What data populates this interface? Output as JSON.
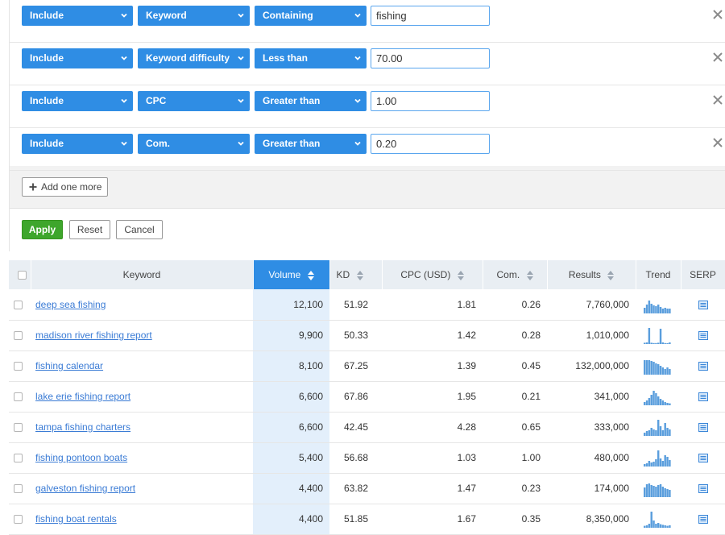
{
  "filters": [
    {
      "include": "Include",
      "field": "Keyword",
      "operator": "Containing",
      "value": "fishing"
    },
    {
      "include": "Include",
      "field": "Keyword difficulty",
      "operator": "Less than",
      "value": "70.00"
    },
    {
      "include": "Include",
      "field": "CPC",
      "operator": "Greater than",
      "value": "1.00"
    },
    {
      "include": "Include",
      "field": "Com.",
      "operator": "Greater than",
      "value": "0.20"
    }
  ],
  "add_more_label": "Add one more",
  "actions": {
    "apply": "Apply",
    "reset": "Reset",
    "cancel": "Cancel"
  },
  "table": {
    "headers": {
      "keyword": "Keyword",
      "volume": "Volume",
      "kd": "KD",
      "cpc": "CPC (USD)",
      "com": "Com.",
      "results": "Results",
      "trend": "Trend",
      "serp": "SERP"
    },
    "rows": [
      {
        "keyword": "deep sea fishing",
        "volume": "12,100",
        "kd": "51.92",
        "cpc": "1.81",
        "com": "0.26",
        "results": "7,760,000",
        "trend": [
          0.35,
          0.55,
          0.8,
          0.6,
          0.5,
          0.45,
          0.55,
          0.4,
          0.3,
          0.35,
          0.3,
          0.3
        ]
      },
      {
        "keyword": "madison river fishing report",
        "volume": "9,900",
        "kd": "50.33",
        "cpc": "1.42",
        "com": "0.28",
        "results": "1,010,000",
        "trend": [
          0.08,
          0.1,
          1.0,
          0.08,
          0.06,
          0.06,
          0.08,
          0.95,
          0.1,
          0.06,
          0.05,
          0.1
        ]
      },
      {
        "keyword": "fishing calendar",
        "volume": "8,100",
        "kd": "67.25",
        "cpc": "1.39",
        "com": "0.45",
        "results": "132,000,000",
        "trend": [
          0.9,
          0.9,
          0.9,
          0.85,
          0.8,
          0.7,
          0.65,
          0.55,
          0.45,
          0.35,
          0.45,
          0.35
        ]
      },
      {
        "keyword": "lake erie fishing report",
        "volume": "6,600",
        "kd": "67.86",
        "cpc": "1.95",
        "com": "0.21",
        "results": "341,000",
        "trend": [
          0.2,
          0.3,
          0.45,
          0.65,
          0.9,
          0.75,
          0.55,
          0.4,
          0.3,
          0.2,
          0.15,
          0.12
        ]
      },
      {
        "keyword": "tampa fishing charters",
        "volume": "6,600",
        "kd": "42.45",
        "cpc": "4.28",
        "com": "0.65",
        "results": "333,000",
        "trend": [
          0.2,
          0.3,
          0.35,
          0.5,
          0.4,
          0.35,
          1.0,
          0.6,
          0.35,
          0.8,
          0.5,
          0.4
        ]
      },
      {
        "keyword": "fishing pontoon boats",
        "volume": "5,400",
        "kd": "56.68",
        "cpc": "1.03",
        "com": "1.00",
        "results": "480,000",
        "trend": [
          0.15,
          0.2,
          0.35,
          0.25,
          0.3,
          0.45,
          1.0,
          0.5,
          0.35,
          0.7,
          0.6,
          0.4
        ]
      },
      {
        "keyword": "galveston fishing report",
        "volume": "4,400",
        "kd": "63.82",
        "cpc": "1.47",
        "com": "0.23",
        "results": "174,000",
        "trend": [
          0.6,
          0.8,
          0.85,
          0.75,
          0.7,
          0.65,
          0.75,
          0.8,
          0.65,
          0.55,
          0.5,
          0.45
        ]
      },
      {
        "keyword": "fishing boat rentals",
        "volume": "4,400",
        "kd": "51.85",
        "cpc": "1.67",
        "com": "0.35",
        "results": "8,350,000",
        "trend": [
          0.12,
          0.15,
          0.25,
          1.0,
          0.45,
          0.25,
          0.3,
          0.22,
          0.18,
          0.15,
          0.12,
          0.15
        ]
      }
    ]
  },
  "colors": {
    "accent": "#2f8de4",
    "apply": "#3ea62c",
    "link": "#3a7bd5",
    "trend": "#5a9edd"
  },
  "icons": {
    "dropdown": "chevron-down-icon",
    "remove": "close-icon",
    "add": "plus-icon",
    "sort": "sort-icon",
    "serp": "serp-icon"
  }
}
